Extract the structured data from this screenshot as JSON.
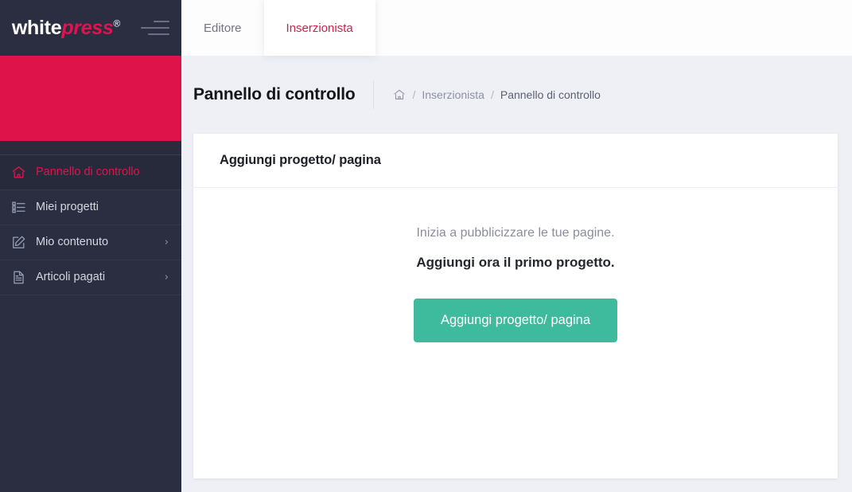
{
  "brand": {
    "name_white": "white",
    "name_accent": "press",
    "registered_mark": "®",
    "menu_icon": "hamburger-icon"
  },
  "colors": {
    "sidebar_bg": "#2b2e40",
    "accent_red": "#dd1349",
    "tab_active_text": "#c8234c",
    "cta_green": "#3ebb9d",
    "page_bg": "#eef0f6"
  },
  "sidebar": {
    "items": [
      {
        "label": "Pannello di controllo",
        "icon": "home-icon",
        "active": true,
        "has_submenu": false
      },
      {
        "label": "Miei progetti",
        "icon": "list-icon",
        "active": false,
        "has_submenu": false
      },
      {
        "label": "Mio contenuto",
        "icon": "edit-square-icon",
        "active": false,
        "has_submenu": true
      },
      {
        "label": "Articoli pagati",
        "icon": "document-icon",
        "active": false,
        "has_submenu": true
      }
    ],
    "caret": "›"
  },
  "topbar": {
    "tabs": [
      {
        "label": "Editore",
        "active": false
      },
      {
        "label": "Inserzionista",
        "active": true
      }
    ]
  },
  "page": {
    "title": "Pannello di controllo",
    "breadcrumb": {
      "home_icon": "home-icon",
      "separator": "/",
      "items": [
        {
          "label": "Inserzionista",
          "current": false
        },
        {
          "label": "Pannello di controllo",
          "current": true
        }
      ]
    }
  },
  "card": {
    "title": "Aggiungi progetto/ pagina",
    "lead": "Inizia a pubblicizzare le tue pagine.",
    "lead_strong": "Aggiungi ora il primo progetto.",
    "cta_label": "Aggiungi progetto/ pagina"
  }
}
